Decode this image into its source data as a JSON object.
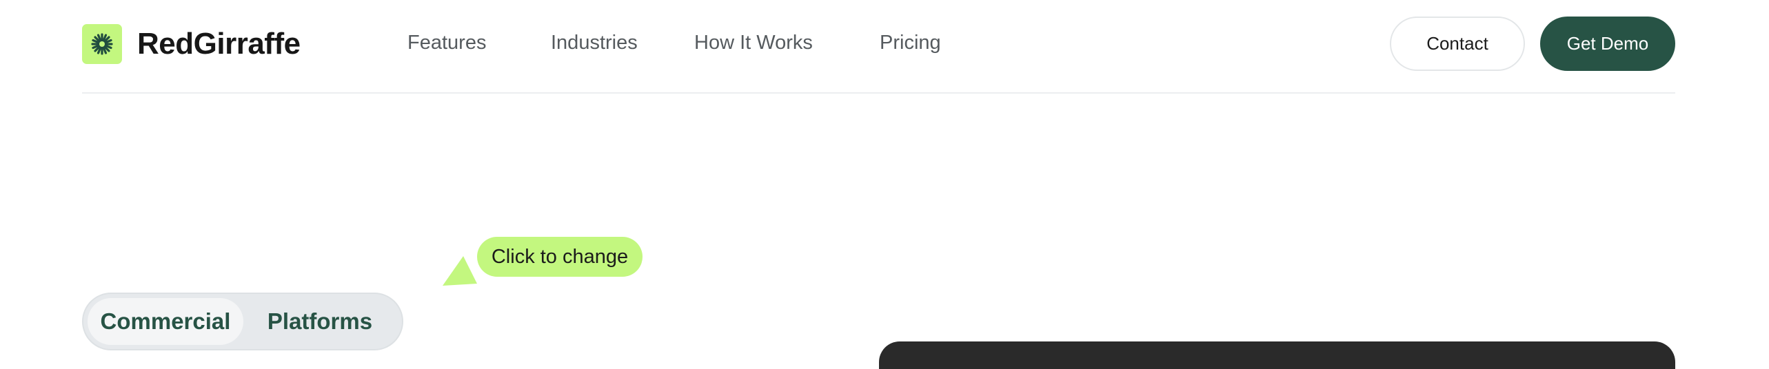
{
  "brand": {
    "name": "RedGirraffe",
    "logo_icon": "starburst-icon",
    "accent": "#c3f77f"
  },
  "nav": {
    "items": [
      "Features",
      "Industries",
      "How It Works",
      "Pricing"
    ]
  },
  "actions": {
    "contact_label": "Contact",
    "demo_label": "Get Demo",
    "demo_color": "#275345"
  },
  "hint": {
    "text": "Click to change"
  },
  "toggle": {
    "options": [
      "Commercial",
      "Platforms"
    ],
    "selected": "Commercial"
  }
}
